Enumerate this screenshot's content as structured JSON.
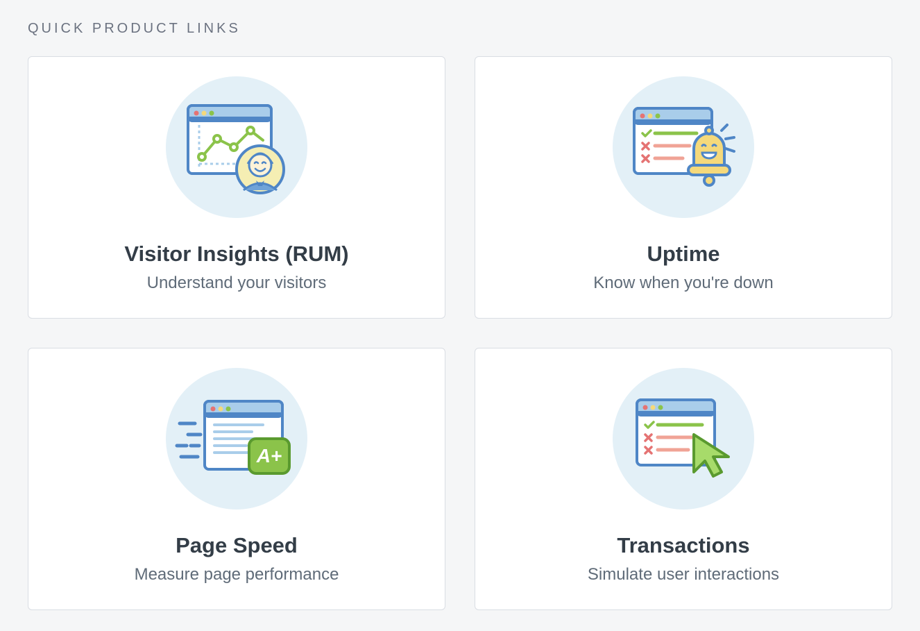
{
  "section_title": "QUICK PRODUCT LINKS",
  "cards": [
    {
      "icon": "visitor-insights-icon",
      "title": "Visitor Insights (RUM)",
      "subtitle": "Understand your visitors"
    },
    {
      "icon": "uptime-icon",
      "title": "Uptime",
      "subtitle": "Know when you're down"
    },
    {
      "icon": "page-speed-icon",
      "title": "Page Speed",
      "subtitle": "Measure page performance"
    },
    {
      "icon": "transactions-icon",
      "title": "Transactions",
      "subtitle": "Simulate user interactions"
    }
  ],
  "colors": {
    "card_border": "#d9dde3",
    "icon_bg": "#e3f0f7",
    "title": "#333d47",
    "subtitle": "#5f6b78",
    "accent_blue": "#4f86c6",
    "accent_green": "#8bc34a",
    "accent_red": "#e57373",
    "accent_yellow": "#f5d97b"
  }
}
